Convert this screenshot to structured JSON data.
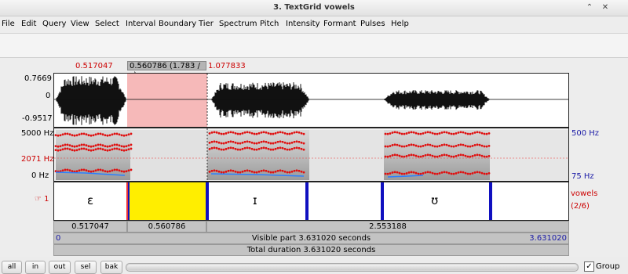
{
  "window": {
    "title": "3. TextGrid vowels",
    "controls": [
      "⌃",
      "✕"
    ]
  },
  "menu": [
    "File",
    "Edit",
    "Query",
    "View",
    "Select",
    "Interval",
    "Boundary",
    "Tier",
    "Spectrum",
    "Pitch",
    "Intensity",
    "Formant",
    "Pulses",
    "Help"
  ],
  "selection": {
    "start": "0.517047",
    "readout": "0.560786 (1.783 / s)",
    "end": "1.077833"
  },
  "waveform": {
    "top": "0.7669",
    "zero": "0",
    "bottom": "-0.9517"
  },
  "spectrogram": {
    "freq_top": "5000 Hz",
    "freq_mid": "2071 Hz",
    "freq_bottom": "0 Hz",
    "pitch_top": "500 Hz",
    "pitch_bottom": "75 Hz"
  },
  "tier": {
    "marker": "☞ 1",
    "name": "vowels",
    "count": "(2/6)",
    "intervals": [
      "ɛ",
      "",
      "ɪ",
      "ʊ"
    ]
  },
  "durations": {
    "left": "0.517047",
    "selected": "0.560786",
    "right": "2.553188"
  },
  "visible": {
    "start": "0",
    "label": "Visible part 3.631020 seconds",
    "end": "3.631020"
  },
  "total": {
    "label": "Total duration 3.631020 seconds"
  },
  "buttons": {
    "all": "all",
    "in": "in",
    "out": "out",
    "sel": "sel",
    "bak": "bak"
  },
  "group": {
    "label": "Group",
    "checked": true
  },
  "colors": {
    "selection": "#f6b9b9",
    "interval": "#ffee00",
    "boundary": "#1010c0",
    "formant": "#e01010",
    "pitch": "#2a7fff"
  }
}
